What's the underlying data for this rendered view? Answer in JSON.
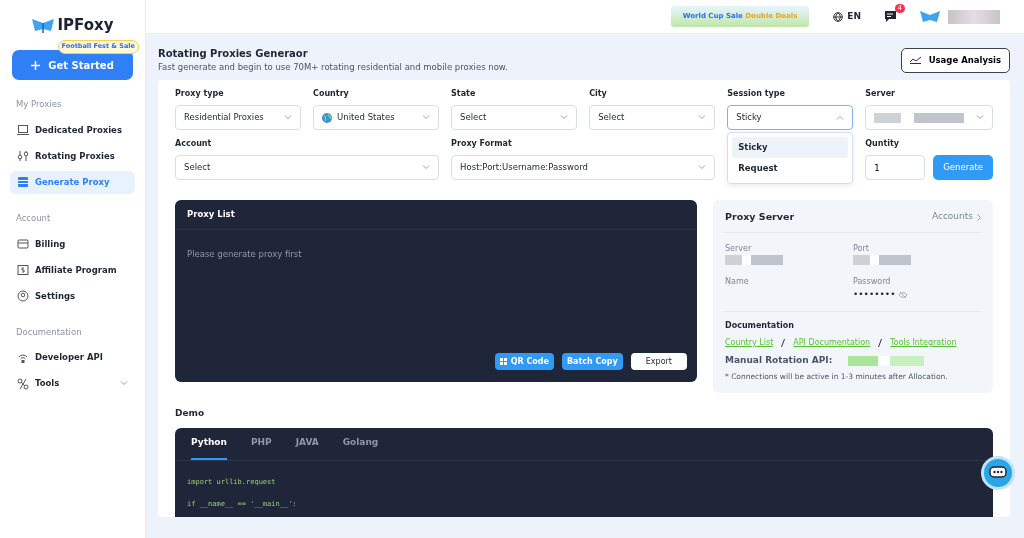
{
  "logo": {
    "text": "IPFoxy"
  },
  "promo_badge": "Football Fest & Sale",
  "get_started": "Get Started",
  "sidebar": {
    "sections": [
      {
        "title": "My Proxies",
        "items": [
          {
            "label": "Dedicated Proxies",
            "selected": false,
            "submenu": false
          },
          {
            "label": "Rotating Proxies",
            "selected": false,
            "submenu": false
          },
          {
            "label": "Generate Proxy",
            "selected": true,
            "submenu": false
          }
        ]
      },
      {
        "title": "Account",
        "items": [
          {
            "label": "Billing",
            "selected": false,
            "submenu": false
          },
          {
            "label": "Affiliate Program",
            "selected": false,
            "submenu": false
          },
          {
            "label": "Settings",
            "selected": false,
            "submenu": false
          }
        ]
      },
      {
        "title": "Documentation",
        "items": [
          {
            "label": "Developer API",
            "selected": false,
            "submenu": false
          },
          {
            "label": "Tools",
            "selected": false,
            "submenu": true
          }
        ]
      }
    ]
  },
  "header": {
    "banner": {
      "text": "World Cup Sale",
      "highlight": "Double Deals"
    },
    "language": "EN",
    "notification_count": "4"
  },
  "page": {
    "title": "Rotating Proxies Generaor",
    "subtitle": "Fast generate and begin to use 70M+ rotating residential and mobile proxies now.",
    "usage_button": "Usage Analysis"
  },
  "form": {
    "fields": [
      {
        "label": "Proxy type",
        "value": "Residential Proxies",
        "kind": "select",
        "open": false
      },
      {
        "label": "Country",
        "value": "United States",
        "kind": "country",
        "open": false
      },
      {
        "label": "State",
        "value": "Select",
        "kind": "select",
        "open": false
      },
      {
        "label": "City",
        "value": "Select",
        "kind": "select",
        "open": false
      },
      {
        "label": "Session type",
        "value": "Sticky",
        "kind": "select",
        "open": true,
        "options": [
          {
            "label": "Sticky",
            "selected": true
          },
          {
            "label": "Request",
            "selected": false
          }
        ]
      },
      {
        "label": "Server",
        "kind": "redacted",
        "open": false
      },
      {
        "label": "Account",
        "value": "Select",
        "kind": "select",
        "open": false
      },
      {
        "label": "Proxy Format",
        "value": "Host:Port:Username:Password",
        "kind": "select",
        "open": false
      },
      {
        "kind": "covered"
      },
      {
        "label": "Quntity",
        "value": "1",
        "kind": "quantity",
        "button": "Generate"
      }
    ]
  },
  "proxy_list": {
    "title": "Proxy List",
    "placeholder": "Please generate proxy first",
    "buttons": [
      {
        "label": "QR Code",
        "kind": "qr"
      },
      {
        "label": "Batch Copy",
        "kind": "primary"
      },
      {
        "label": "Export",
        "kind": "light"
      }
    ]
  },
  "proxy_server": {
    "title": "Proxy Server",
    "link": "Accounts",
    "fields": [
      {
        "label": "Server",
        "kind": "redacted"
      },
      {
        "label": "Port",
        "kind": "redacted"
      },
      {
        "label": "Name",
        "kind": "empty"
      },
      {
        "label": "Password",
        "value": "••••••••",
        "kind": "secret"
      }
    ],
    "documentation": {
      "title": "Documentation",
      "links": [
        "Country List",
        "API Documentation",
        "Tools Integration"
      ],
      "rotation_label": "Manual Rotation API:",
      "note": "* Connections will be active in 1-3 minutes after Allocation."
    }
  },
  "demo": {
    "title": "Demo",
    "tabs": [
      {
        "label": "Python",
        "selected": true
      },
      {
        "label": "PHP",
        "selected": false
      },
      {
        "label": "JAVA",
        "selected": false
      },
      {
        "label": "Golang",
        "selected": false
      }
    ],
    "code": [
      "import urllib.request",
      "if __name__ == '__main__':"
    ]
  }
}
